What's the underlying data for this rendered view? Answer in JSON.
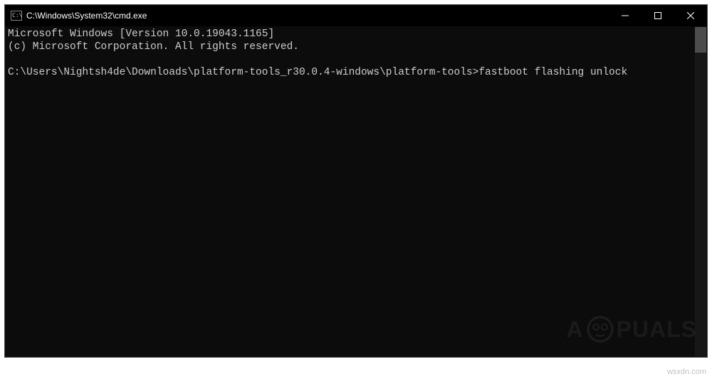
{
  "window": {
    "title": "C:\\Windows\\System32\\cmd.exe"
  },
  "terminal": {
    "lines": {
      "l0": "Microsoft Windows [Version 10.0.19043.1165]",
      "l1": "(c) Microsoft Corporation. All rights reserved.",
      "l2": "",
      "l3_prompt": "C:\\Users\\Nightsh4de\\Downloads\\platform-tools_r30.0.4-windows\\platform-tools>",
      "l3_command": "fastboot flashing unlock"
    }
  },
  "icons": {
    "cmd": "cmd-icon",
    "minimize": "minimize-icon",
    "maximize": "maximize-icon",
    "close": "close-icon"
  },
  "watermark": {
    "brand_left": "A",
    "brand_right": "PUALS",
    "site": "wsxdn.com"
  }
}
